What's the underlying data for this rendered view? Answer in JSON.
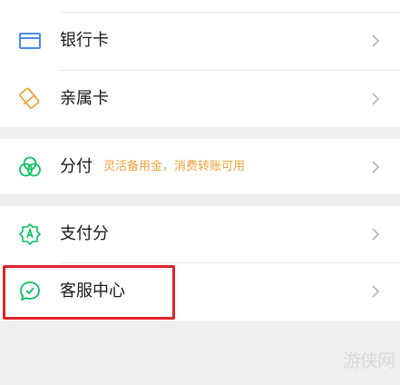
{
  "menu": {
    "items": [
      {
        "label": "银行卡",
        "icon": "bank-card-icon"
      },
      {
        "label": "亲属卡",
        "icon": "family-card-icon"
      },
      {
        "label": "分付",
        "sub": "灵活备用金，消费转账可用",
        "icon": "installment-pay-icon"
      },
      {
        "label": "支付分",
        "icon": "pay-score-icon"
      },
      {
        "label": "客服中心",
        "icon": "customer-service-icon"
      }
    ]
  },
  "watermark": {
    "text": "游侠网"
  },
  "colors": {
    "accent": "#07c160",
    "card_icon": "#2f7ee8",
    "family_icon": "#f0a33a",
    "sub_text": "#f0a33a",
    "highlight": "#e1232b"
  }
}
